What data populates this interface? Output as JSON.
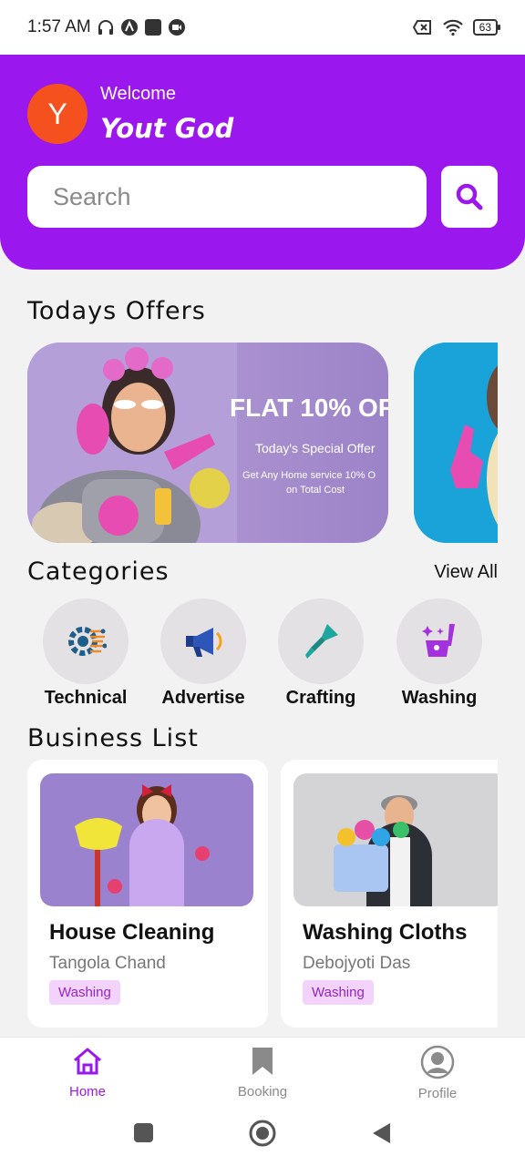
{
  "status_bar": {
    "time": "1:57 AM",
    "battery": "63"
  },
  "header": {
    "avatar_letter": "Y",
    "welcome": "Welcome",
    "username": "Yout God",
    "search_placeholder": "Search"
  },
  "offers": {
    "title": "Todays Offers",
    "card1": {
      "headline": "FLAT 10% OF",
      "subtitle": "Today's Special Offer",
      "desc_line1": "Get Any Home service 10% O",
      "desc_line2": "on Total Cost"
    }
  },
  "categories": {
    "title": "Categories",
    "view_all": "View All",
    "items": [
      {
        "label": "Technical",
        "icon": "gear-circuit-icon"
      },
      {
        "label": "Advertise",
        "icon": "megaphone-icon"
      },
      {
        "label": "Crafting",
        "icon": "paint-brush-icon"
      },
      {
        "label": "Washing",
        "icon": "cleaning-bucket-icon"
      }
    ]
  },
  "business": {
    "title": "Business List",
    "items": [
      {
        "title": "House Cleaning",
        "owner": "Tangola Chand",
        "tag": "Washing"
      },
      {
        "title": "Washing Cloths",
        "owner": "Debojyoti Das",
        "tag": "Washing"
      }
    ]
  },
  "nav": {
    "items": [
      {
        "label": "Home",
        "icon": "home-icon",
        "active": true
      },
      {
        "label": "Booking",
        "icon": "bookmark-icon",
        "active": false
      },
      {
        "label": "Profile",
        "icon": "profile-icon",
        "active": false
      }
    ]
  },
  "colors": {
    "accent": "#9a18ee",
    "avatar_bg": "#f4511e",
    "tag_bg": "#f3d2fb",
    "tag_text": "#8f28c7",
    "nav_active": "#9a18ee",
    "nav_inactive": "#8a8a8a"
  }
}
